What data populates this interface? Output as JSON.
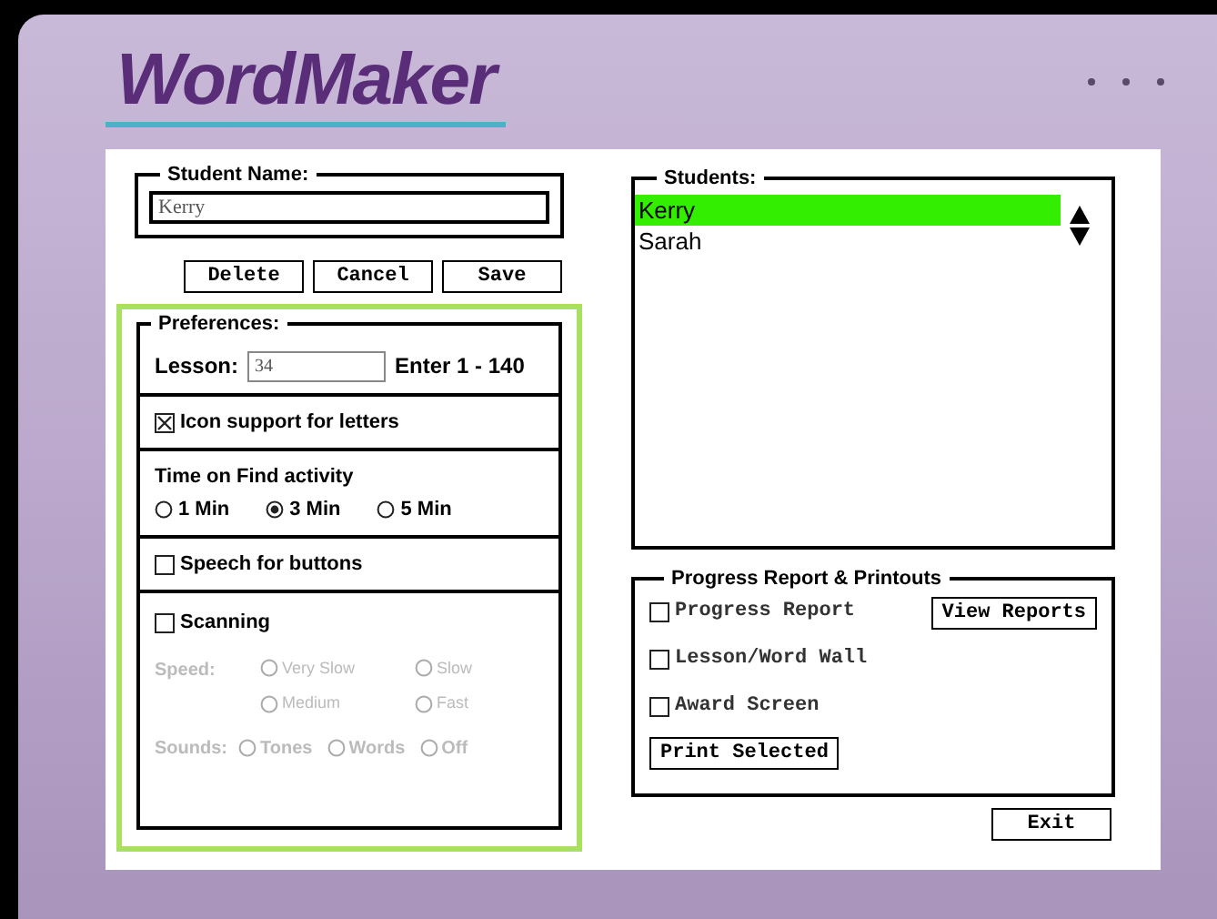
{
  "app": {
    "title": "WordMaker"
  },
  "student_name": {
    "label": "Student Name:",
    "value": "Kerry"
  },
  "name_buttons": [
    "Delete",
    "Cancel",
    "Save"
  ],
  "preferences": {
    "label": "Preferences:",
    "lesson": {
      "label": "Lesson:",
      "value": "34",
      "hint": "Enter 1 - 140"
    },
    "icon_support": {
      "label": "Icon support for letters",
      "checked": true
    },
    "time_on_find": {
      "label": "Time on Find activity",
      "options": [
        {
          "label": "1 Min",
          "selected": false
        },
        {
          "label": "3 Min",
          "selected": true
        },
        {
          "label": "5 Min",
          "selected": false
        }
      ]
    },
    "speech": {
      "label": "Speech for buttons",
      "checked": false
    },
    "scanning": {
      "label": "Scanning",
      "checked": false,
      "speed": {
        "label": "Speed:",
        "options": [
          {
            "label": "Very Slow",
            "selected": false
          },
          {
            "label": "Slow",
            "selected": false
          },
          {
            "label": "Medium",
            "selected": false
          },
          {
            "label": "Fast",
            "selected": false
          }
        ]
      },
      "sounds": {
        "label": "Sounds:",
        "options": [
          {
            "label": "Tones",
            "selected": false
          },
          {
            "label": "Words",
            "selected": false
          },
          {
            "label": "Off",
            "selected": false
          }
        ]
      }
    }
  },
  "students": {
    "label": "Students:",
    "items": [
      {
        "name": "Kerry",
        "selected": true
      },
      {
        "name": "Sarah",
        "selected": false
      }
    ]
  },
  "progress": {
    "label": "Progress Report & Printouts",
    "items": [
      {
        "label": "Progress Report",
        "checked": false
      },
      {
        "label": "Lesson/Word Wall",
        "checked": false
      },
      {
        "label": "Award Screen",
        "checked": false
      }
    ],
    "view_button": "View Reports",
    "print_button": "Print Selected"
  },
  "exit_button": "Exit"
}
